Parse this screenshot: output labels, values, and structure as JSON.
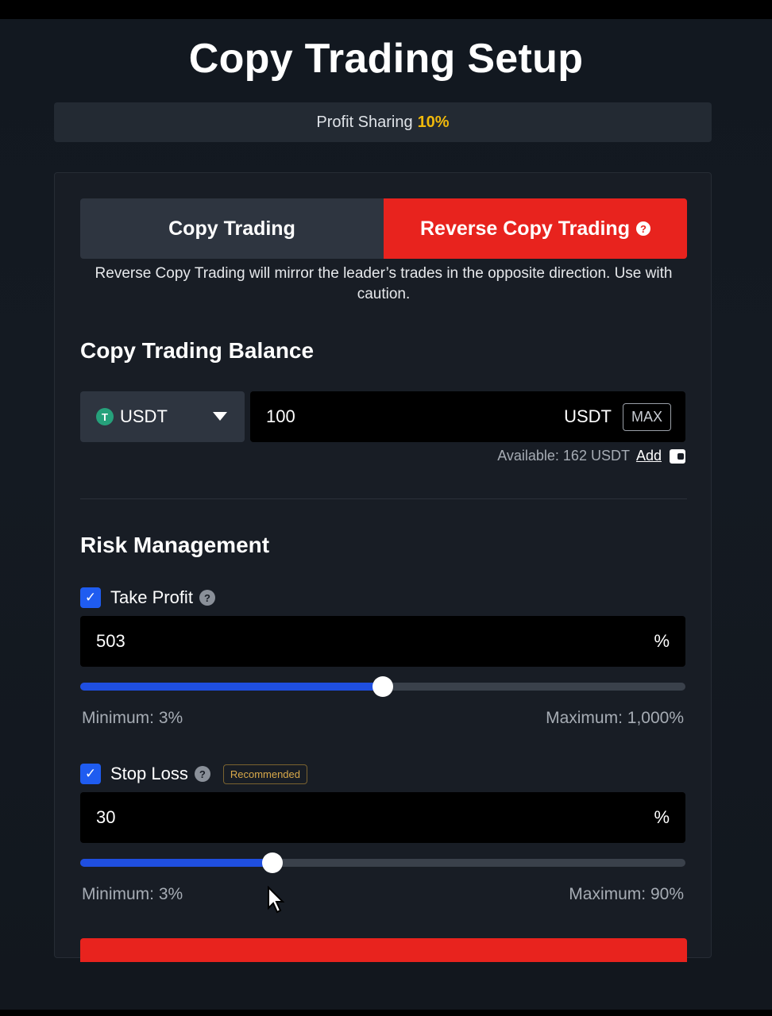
{
  "page": {
    "title": "Copy Trading Setup"
  },
  "profit_sharing": {
    "label": "Profit Sharing",
    "value": "10%"
  },
  "tabs": [
    {
      "label": "Copy Trading",
      "active": false
    },
    {
      "label": "Reverse Copy Trading",
      "active": true,
      "help_icon": "question-icon"
    }
  ],
  "reverse_warning": "Reverse Copy Trading will mirror the leader’s trades in the opposite direction. Use with caution.",
  "balance": {
    "section_title": "Copy Trading Balance",
    "currency": "USDT",
    "amount": "100",
    "unit": "USDT",
    "max_label": "MAX",
    "available_text": "Available: 162 USDT",
    "add_label": "Add"
  },
  "risk": {
    "section_title": "Risk Management",
    "take_profit": {
      "label": "Take Profit",
      "checked": true,
      "value": "503",
      "unit": "%",
      "slider_fraction": 0.5,
      "min_label": "Minimum: 3%",
      "max_label": "Maximum: 1,000%"
    },
    "stop_loss": {
      "label": "Stop Loss",
      "checked": true,
      "badge": "Recommended",
      "value": "30",
      "unit": "%",
      "slider_fraction": 0.317,
      "min_label": "Minimum: 3%",
      "max_label": "Maximum: 90%"
    }
  },
  "colors": {
    "accent_red": "#e8231e",
    "accent_blue": "#1f4fe0",
    "gold": "#f0b90b"
  }
}
